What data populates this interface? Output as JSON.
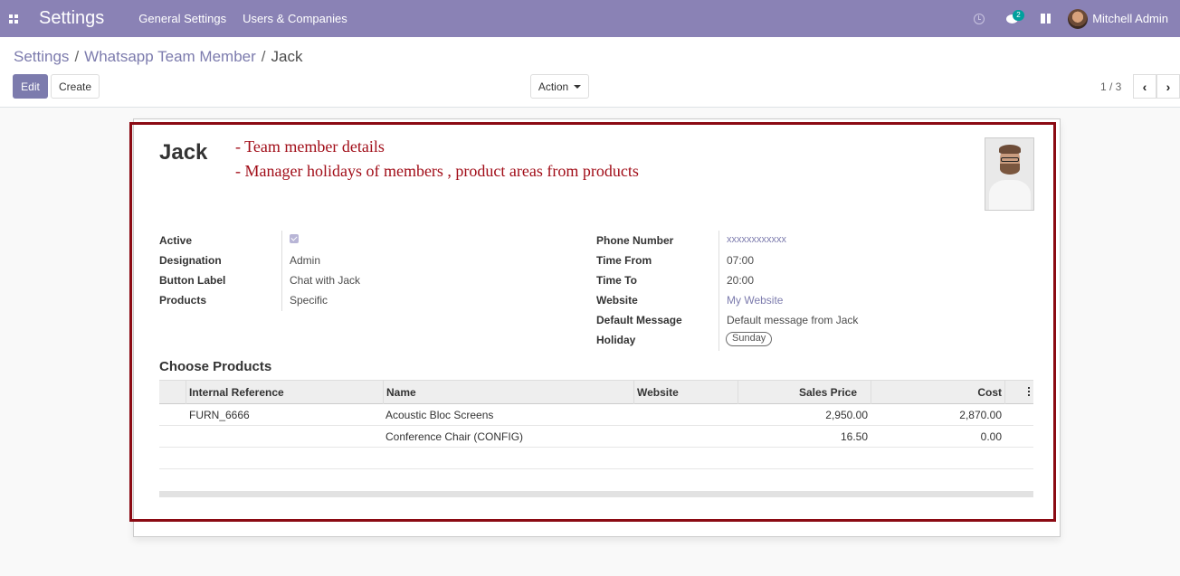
{
  "navbar": {
    "app_title": "Settings",
    "menu": [
      "General Settings",
      "Users & Companies"
    ],
    "chat_badge": "2",
    "user_name": "Mitchell Admin"
  },
  "breadcrumb": {
    "items": [
      "Settings",
      "Whatsapp Team Member",
      "Jack"
    ],
    "separator": "/"
  },
  "buttons": {
    "edit": "Edit",
    "create": "Create",
    "action": "Action"
  },
  "pager": {
    "value": "1 / 3"
  },
  "record": {
    "name": "Jack",
    "annotations": [
      "- Team member details",
      "- Manager holidays of members , product areas from products"
    ],
    "left_fields": [
      {
        "label": "Active",
        "value": "checked"
      },
      {
        "label": "Designation",
        "value": "Admin"
      },
      {
        "label": "Button Label",
        "value": "Chat with Jack"
      },
      {
        "label": "Products",
        "value": "Specific"
      }
    ],
    "right_fields": [
      {
        "label": "Phone Number",
        "value": "xxxxxxxxxxxx"
      },
      {
        "label": "Time From",
        "value": "07:00"
      },
      {
        "label": "Time To",
        "value": "20:00"
      },
      {
        "label": "Website",
        "value": "My Website"
      },
      {
        "label": "Default Message",
        "value": "Default message from Jack"
      },
      {
        "label": "Holiday",
        "value": "Sunday"
      }
    ]
  },
  "products": {
    "title": "Choose Products",
    "columns": [
      "Internal Reference",
      "Name",
      "Website",
      "Sales Price",
      "Cost"
    ],
    "rows": [
      {
        "ref": "FURN_6666",
        "name": "Acoustic Bloc Screens",
        "website": "",
        "price": "2,950.00",
        "cost": "2,870.00"
      },
      {
        "ref": "",
        "name": "Conference Chair (CONFIG)",
        "website": "",
        "price": "16.50",
        "cost": "0.00"
      }
    ]
  },
  "colors": {
    "navbar": "#8a82b5",
    "primary": "#7c7bad",
    "annotation": "#a10d18",
    "highlight_border": "#8b0a13"
  },
  "icons": [
    "apps-icon",
    "clock-icon",
    "chat-icon",
    "gift-icon",
    "chevron-left-icon",
    "chevron-right-icon",
    "column-options-icon"
  ]
}
